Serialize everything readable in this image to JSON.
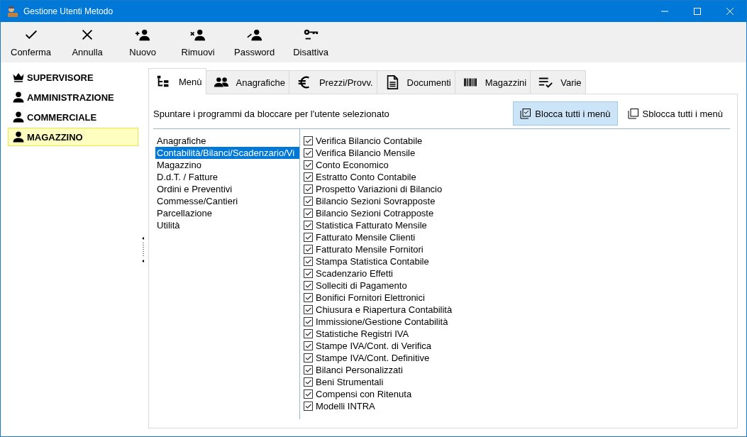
{
  "window": {
    "title": "Gestione Utenti Metodo"
  },
  "toolbar": [
    {
      "label": "Conferma"
    },
    {
      "label": "Annulla"
    },
    {
      "label": "Nuovo"
    },
    {
      "label": "Rimuovi"
    },
    {
      "label": "Password"
    },
    {
      "label": "Disattiva"
    }
  ],
  "users": [
    {
      "name": "SUPERVISORE",
      "kind": "admin",
      "selected": false
    },
    {
      "name": "AMMINISTRAZIONE",
      "kind": "user",
      "selected": false
    },
    {
      "name": "COMMERCIALE",
      "kind": "user",
      "selected": false
    },
    {
      "name": "MAGAZZINO",
      "kind": "user",
      "selected": true
    }
  ],
  "tabs": [
    {
      "label": "Menù",
      "selected": true
    },
    {
      "label": "Anagrafiche",
      "selected": false
    },
    {
      "label": "Prezzi/Provv.",
      "selected": false
    },
    {
      "label": "Documenti",
      "selected": false
    },
    {
      "label": "Magazzini",
      "selected": false
    },
    {
      "label": "Varie",
      "selected": false
    }
  ],
  "instruction": "Spuntare i programmi da bloccare per l'utente selezionato",
  "lock_all_button": {
    "label": "Blocca tutti i menù",
    "hovered": true
  },
  "unlock_all_button": {
    "label": "Sblocca tutti i menù",
    "hovered": false
  },
  "categories": [
    {
      "label": "Anagrafiche",
      "selected": false
    },
    {
      "label": "Contabilità/Bilanci/Scadenzario/Vi",
      "selected": true
    },
    {
      "label": "Magazzino",
      "selected": false
    },
    {
      "label": "D.d.T. / Fatture",
      "selected": false
    },
    {
      "label": "Ordini e Preventivi",
      "selected": false
    },
    {
      "label": "Commesse/Cantieri",
      "selected": false
    },
    {
      "label": "Parcellazione",
      "selected": false
    },
    {
      "label": "Utilità",
      "selected": false
    }
  ],
  "programs": [
    {
      "label": "Verifica Bilancio Contabile",
      "checked": true
    },
    {
      "label": "Verifica Bilancio Mensile",
      "checked": true
    },
    {
      "label": "Conto Economico",
      "checked": true
    },
    {
      "label": "Estratto Conto Contabile",
      "checked": true
    },
    {
      "label": "Prospetto Variazioni di Bilancio",
      "checked": true
    },
    {
      "label": "Bilancio Sezioni Sovrapposte",
      "checked": true
    },
    {
      "label": "Bilancio Sezioni Cotrapposte",
      "checked": true
    },
    {
      "label": "Statistica Fatturato Mensile",
      "checked": true
    },
    {
      "label": "Fatturato Mensile Clienti",
      "checked": true
    },
    {
      "label": "Fatturato Mensile Fornitori",
      "checked": true
    },
    {
      "label": "Stampa Statistica Contabile",
      "checked": true
    },
    {
      "label": "Scadenzario Effetti",
      "checked": true
    },
    {
      "label": "Solleciti di Pagamento",
      "checked": true
    },
    {
      "label": "Bonifici Fornitori Elettronici",
      "checked": true
    },
    {
      "label": "Chiusura e Riapertura Contabilità",
      "checked": true
    },
    {
      "label": "Immissione/Gestione Contabilità",
      "checked": true
    },
    {
      "label": "Statistiche Registri IVA",
      "checked": true
    },
    {
      "label": "Stampe IVA/Cont. di Verifica",
      "checked": true
    },
    {
      "label": "Stampe IVA/Cont. Definitive",
      "checked": true
    },
    {
      "label": "Bilanci Personalizzati",
      "checked": true
    },
    {
      "label": "Beni Strumentali",
      "checked": true
    },
    {
      "label": "Compensi con Ritenuta",
      "checked": true
    },
    {
      "label": "Modelli INTRA",
      "checked": true
    }
  ]
}
